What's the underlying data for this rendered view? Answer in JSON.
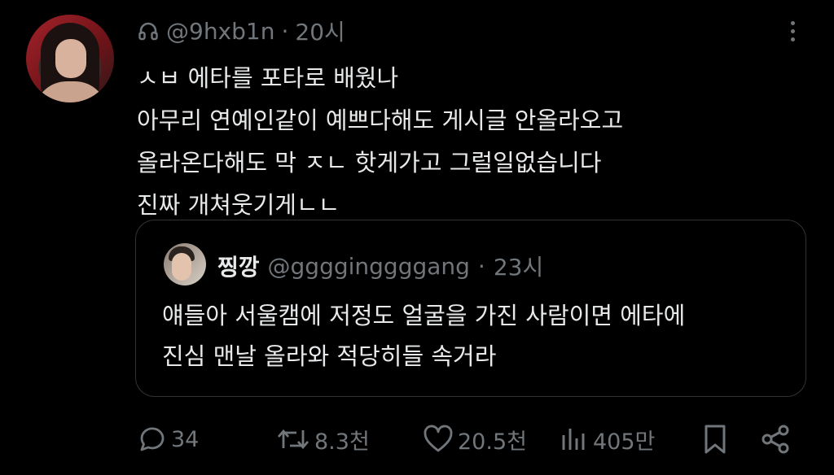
{
  "tweet": {
    "handle": "@9hxb1n",
    "separator": "·",
    "time": "20시",
    "lines": [
      "ㅅㅂ 에타를 포타로 배웠나",
      "아무리 연예인같이 예쁘다해도 게시글 안올라오고",
      "올라온다해도 막 ㅈㄴ 핫게가고 그럴일없습니다",
      "진짜 개쳐웃기게ㄴㄴ"
    ]
  },
  "quoted": {
    "name": "찡깡",
    "handle": "@gggginggggang",
    "separator": "·",
    "time": "23시",
    "lines": [
      "얘들아 서울캠에 저정도 얼굴을 가진 사람이면 에타에",
      "진심 맨날 올라와 적당히들 속거라"
    ]
  },
  "actions": {
    "replies": "34",
    "retweets": "8.3천",
    "likes": "20.5천",
    "views": "405만"
  },
  "icons": {
    "badge": "headphones-icon",
    "more": "more-vertical-icon",
    "reply": "reply-icon",
    "retweet": "retweet-icon",
    "like": "heart-icon",
    "views": "views-icon",
    "bookmark": "bookmark-icon",
    "share": "share-icon"
  }
}
